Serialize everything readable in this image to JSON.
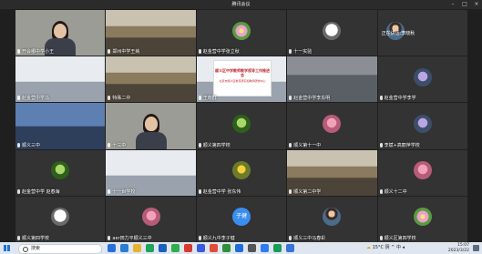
{
  "window": {
    "title": "腾讯会议"
  },
  "tiles": [
    {
      "label": "开会哪中学小王",
      "top_name": ""
    },
    {
      "label": "郑州中学王纳",
      "top_name": ""
    },
    {
      "label": "赵金营中学张立秋",
      "top_name": ""
    },
    {
      "label": "十一实验",
      "top_name": ""
    },
    {
      "label": "",
      "top_name": "正在讲话:李晓秋"
    },
    {
      "label": "赵金营中学马",
      "top_name": ""
    },
    {
      "label": "特殊二中",
      "top_name": ""
    },
    {
      "label": "王晓群",
      "top_name": ""
    },
    {
      "label": "赵金营中学李东明",
      "top_name": ""
    },
    {
      "label": "赵金营中学李学",
      "top_name": ""
    },
    {
      "label": "顺义三中",
      "top_name": ""
    },
    {
      "label": "十三中",
      "top_name": ""
    },
    {
      "label": "顺义第四学校",
      "top_name": ""
    },
    {
      "label": "赵金营中学 刘晓",
      "top_name": ""
    },
    {
      "label": "顺义第十一中",
      "top_name": ""
    },
    {
      "label": "李斌+高丽萍学校",
      "top_name": ""
    },
    {
      "label": "赵金营中学 赵春海",
      "top_name": ""
    },
    {
      "label": "十一世学校",
      "top_name": ""
    },
    {
      "label": "赵金营中学 张东伟",
      "top_name": ""
    },
    {
      "label": "顺义第二中学",
      "top_name": ""
    },
    {
      "label": "顺义十二中",
      "top_name": ""
    },
    {
      "label": "顺义第四学校",
      "top_name": ""
    },
    {
      "label": "aer田力平顺义三中",
      "top_name": ""
    },
    {
      "label": "顺义九中李子健",
      "top_name": ""
    },
    {
      "label": "顺义三中马春彩",
      "top_name": ""
    },
    {
      "label": "顺义区第四学校",
      "top_name": ""
    }
  ],
  "slide": {
    "title": "顺义区中学教师教学视导工作推进会",
    "subtitle": "北京市顺义区教育研究和教师研修中心"
  },
  "avatar_text": "子健",
  "taskbar": {
    "search_placeholder": "搜索",
    "weather": "15°C 阴",
    "ime": "中",
    "time": "15:07",
    "date": "2023/3/22"
  }
}
